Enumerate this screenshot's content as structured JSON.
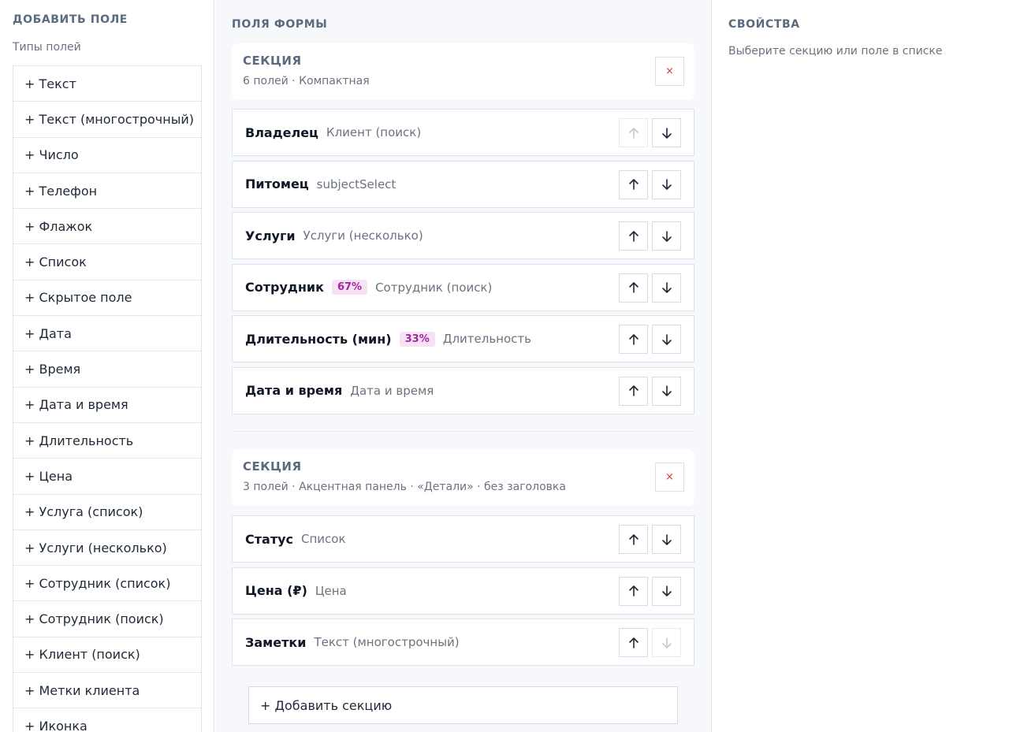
{
  "left_panel": {
    "title": "ДОБАВИТЬ ПОЛЕ",
    "subtitle": "Типы полей",
    "field_types": [
      "+ Текст",
      "+ Текст (многострочный)",
      "+ Число",
      "+ Телефон",
      "+ Флажок",
      "+ Список",
      "+ Скрытое поле",
      "+ Дата",
      "+ Время",
      "+ Дата и время",
      "+ Длительность",
      "+ Цена",
      "+ Услуга (список)",
      "+ Услуги (несколько)",
      "+ Сотрудник (список)",
      "+ Сотрудник (поиск)",
      "+ Клиент (поиск)",
      "+ Метки клиента",
      "+ Иконка"
    ]
  },
  "middle_panel": {
    "title": "ПОЛЯ ФОРМЫ",
    "sections": [
      {
        "label": "СЕКЦИЯ",
        "meta": "6 полей · Компактная",
        "delete_label": "×",
        "fields": [
          {
            "name": "Владелец",
            "badge": "",
            "type": "Клиент (поиск)",
            "up_enabled": false,
            "down_enabled": true
          },
          {
            "name": "Питомец",
            "badge": "",
            "type": "subjectSelect",
            "up_enabled": true,
            "down_enabled": true
          },
          {
            "name": "Услуги",
            "badge": "",
            "type": "Услуги (несколько)",
            "up_enabled": true,
            "down_enabled": true
          },
          {
            "name": "Сотрудник",
            "badge": "67%",
            "type": "Сотрудник (поиск)",
            "up_enabled": true,
            "down_enabled": true
          },
          {
            "name": "Длительность (мин)",
            "badge": "33%",
            "type": "Длительность",
            "up_enabled": true,
            "down_enabled": true
          },
          {
            "name": "Дата и время",
            "badge": "",
            "type": "Дата и время",
            "up_enabled": true,
            "down_enabled": true
          }
        ]
      },
      {
        "label": "СЕКЦИЯ",
        "meta": "3 полей · Акцентная панель · «Детали» · без заголовка",
        "delete_label": "×",
        "fields": [
          {
            "name": "Статус",
            "badge": "",
            "type": "Список",
            "up_enabled": true,
            "down_enabled": true
          },
          {
            "name": "Цена (₽)",
            "badge": "",
            "type": "Цена",
            "up_enabled": true,
            "down_enabled": true
          },
          {
            "name": "Заметки",
            "badge": "",
            "type": "Текст (многострочный)",
            "up_enabled": true,
            "down_enabled": false
          }
        ]
      }
    ],
    "add_section_label": "+ Добавить секцию"
  },
  "right_panel": {
    "title": "СВОЙСТВА",
    "hint": "Выберите секцию или поле в списке"
  },
  "colors": {
    "badge_text": "#9c2a9c",
    "badge_bg": "#f6e2f4",
    "delete_icon": "#d23a3a",
    "heading": "#5b6b7f"
  }
}
